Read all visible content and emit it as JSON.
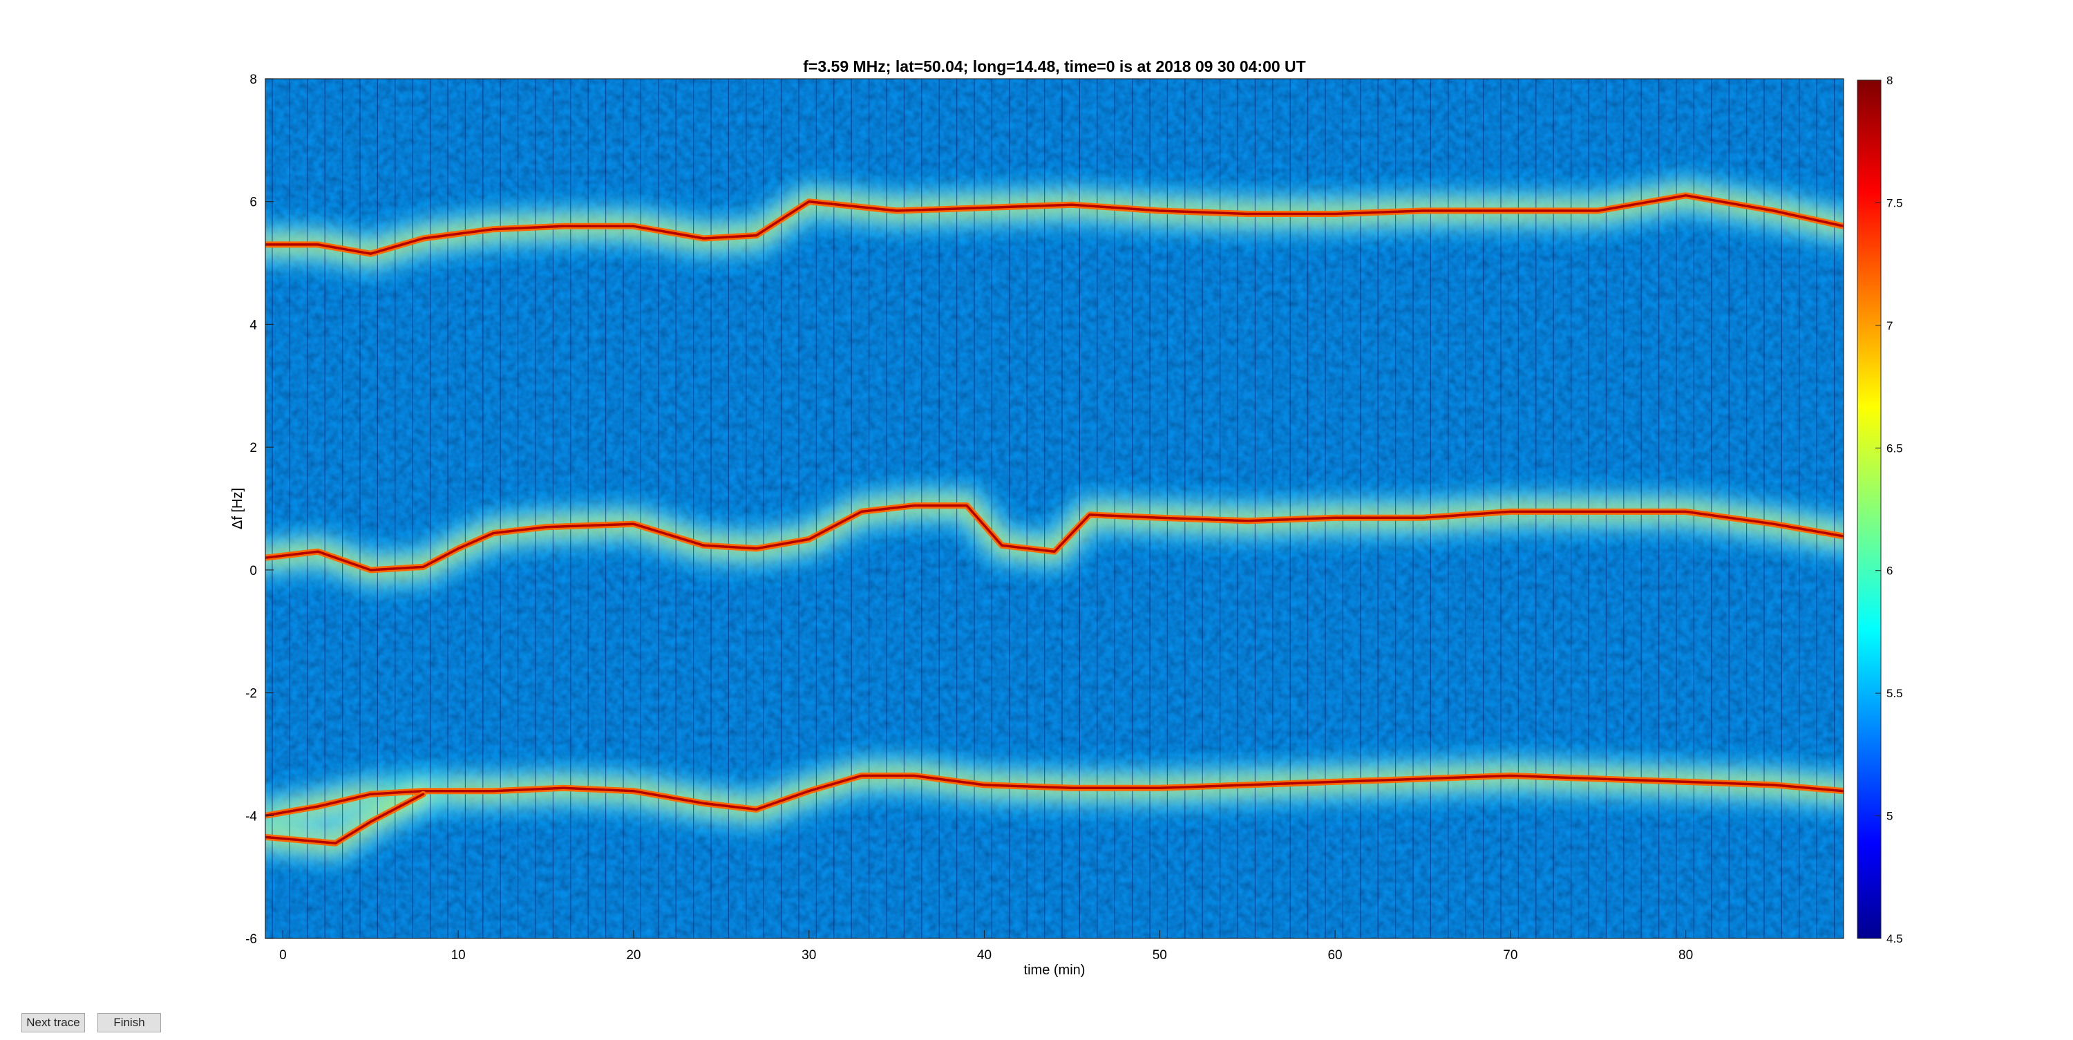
{
  "chart_data": {
    "type": "heatmap",
    "title": "f=3.59 MHz;  lat=50.04; long=14.48, time=0 is at 2018 09 30 04:00 UT",
    "xlabel": "time (min)",
    "ylabel": "Δf [Hz]",
    "xlim": [
      -1,
      89
    ],
    "ylim": [
      -6,
      8
    ],
    "xticks": [
      "0",
      "10",
      "20",
      "30",
      "40",
      "50",
      "60",
      "70",
      "80"
    ],
    "xtick_values": [
      0,
      10,
      20,
      30,
      40,
      50,
      60,
      70,
      80
    ],
    "yticks": [
      "-6",
      "-4",
      "-2",
      "0",
      "2",
      "4",
      "6",
      "8"
    ],
    "ytick_values": [
      -6,
      -4,
      -2,
      0,
      2,
      4,
      6,
      8
    ],
    "colormap": "jet",
    "colorbar": {
      "range": [
        4.5,
        8
      ],
      "ticks": [
        "4.5",
        "5",
        "5.5",
        "6",
        "6.5",
        "7",
        "7.5",
        "8"
      ],
      "tick_values": [
        4.5,
        5,
        5.5,
        6,
        6.5,
        7,
        7.5,
        8
      ]
    },
    "grid": false,
    "traces": [
      {
        "x": [
          -1,
          2,
          5,
          8,
          12,
          16,
          20,
          24,
          27,
          30,
          35,
          40,
          45,
          50,
          55,
          60,
          65,
          70,
          75,
          80,
          85,
          89
        ],
        "y": [
          5.3,
          5.3,
          5.15,
          5.4,
          5.55,
          5.6,
          5.6,
          5.4,
          5.45,
          6.0,
          5.85,
          5.9,
          5.95,
          5.85,
          5.8,
          5.8,
          5.85,
          5.85,
          5.85,
          6.1,
          5.85,
          5.6
        ]
      },
      {
        "x": [
          -1,
          2,
          5,
          8,
          10,
          12,
          15,
          20,
          24,
          27,
          30,
          33,
          36,
          39,
          41,
          44,
          46,
          50,
          55,
          60,
          65,
          70,
          75,
          80,
          85,
          89
        ],
        "y": [
          0.2,
          0.3,
          0.0,
          0.05,
          0.35,
          0.6,
          0.7,
          0.75,
          0.4,
          0.35,
          0.5,
          0.95,
          1.05,
          1.05,
          0.4,
          0.3,
          0.9,
          0.85,
          0.8,
          0.85,
          0.85,
          0.95,
          0.95,
          0.95,
          0.75,
          0.55
        ]
      },
      {
        "x": [
          -1,
          2,
          5,
          8,
          12,
          16,
          20,
          24,
          27,
          30,
          33,
          36,
          40,
          45,
          50,
          55,
          60,
          65,
          70,
          75,
          80,
          85,
          89
        ],
        "y": [
          -4.0,
          -3.85,
          -3.65,
          -3.6,
          -3.6,
          -3.55,
          -3.6,
          -3.8,
          -3.9,
          -3.6,
          -3.35,
          -3.35,
          -3.5,
          -3.55,
          -3.55,
          -3.5,
          -3.45,
          -3.4,
          -3.35,
          -3.4,
          -3.45,
          -3.5,
          -3.6
        ]
      },
      {
        "x": [
          -1,
          1,
          3,
          5,
          8
        ],
        "y": [
          -4.35,
          -4.4,
          -4.45,
          -4.1,
          -3.65
        ]
      }
    ]
  },
  "buttons": {
    "next_trace": "Next trace",
    "finish": "Finish"
  }
}
